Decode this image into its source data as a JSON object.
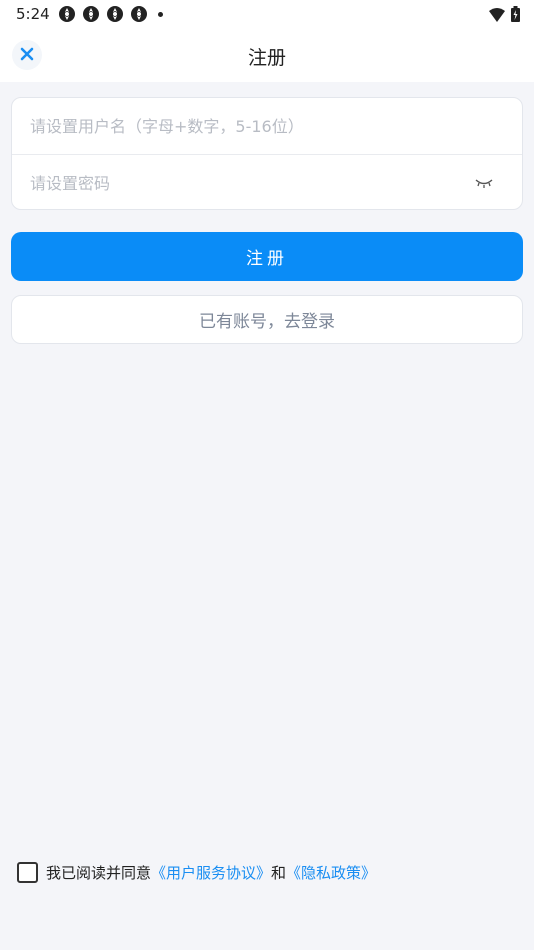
{
  "status_bar": {
    "time": "5:24",
    "notification_icons": [
      "app-icon",
      "app-icon",
      "app-icon",
      "app-icon"
    ],
    "signal_icon": "wifi-icon",
    "battery_icon": "battery-charging-icon"
  },
  "header": {
    "close_icon": "close-icon",
    "title": "注册"
  },
  "form": {
    "username_placeholder": "请设置用户名（字母+数字，5-16位）",
    "username_value": "",
    "password_placeholder": "请设置密码",
    "password_value": "",
    "password_toggle_icon": "eye-closed-icon"
  },
  "buttons": {
    "register_label": "注册",
    "login_label": "已有账号，去登录"
  },
  "agreement": {
    "checked": false,
    "prefix": "我已阅读并同意",
    "terms_link": "《用户服务协议》",
    "conjunction": "和",
    "privacy_link": "《隐私政策》"
  },
  "colors": {
    "accent": "#0a8cf7",
    "link": "#1a8ef2",
    "background": "#f4f5f9"
  }
}
